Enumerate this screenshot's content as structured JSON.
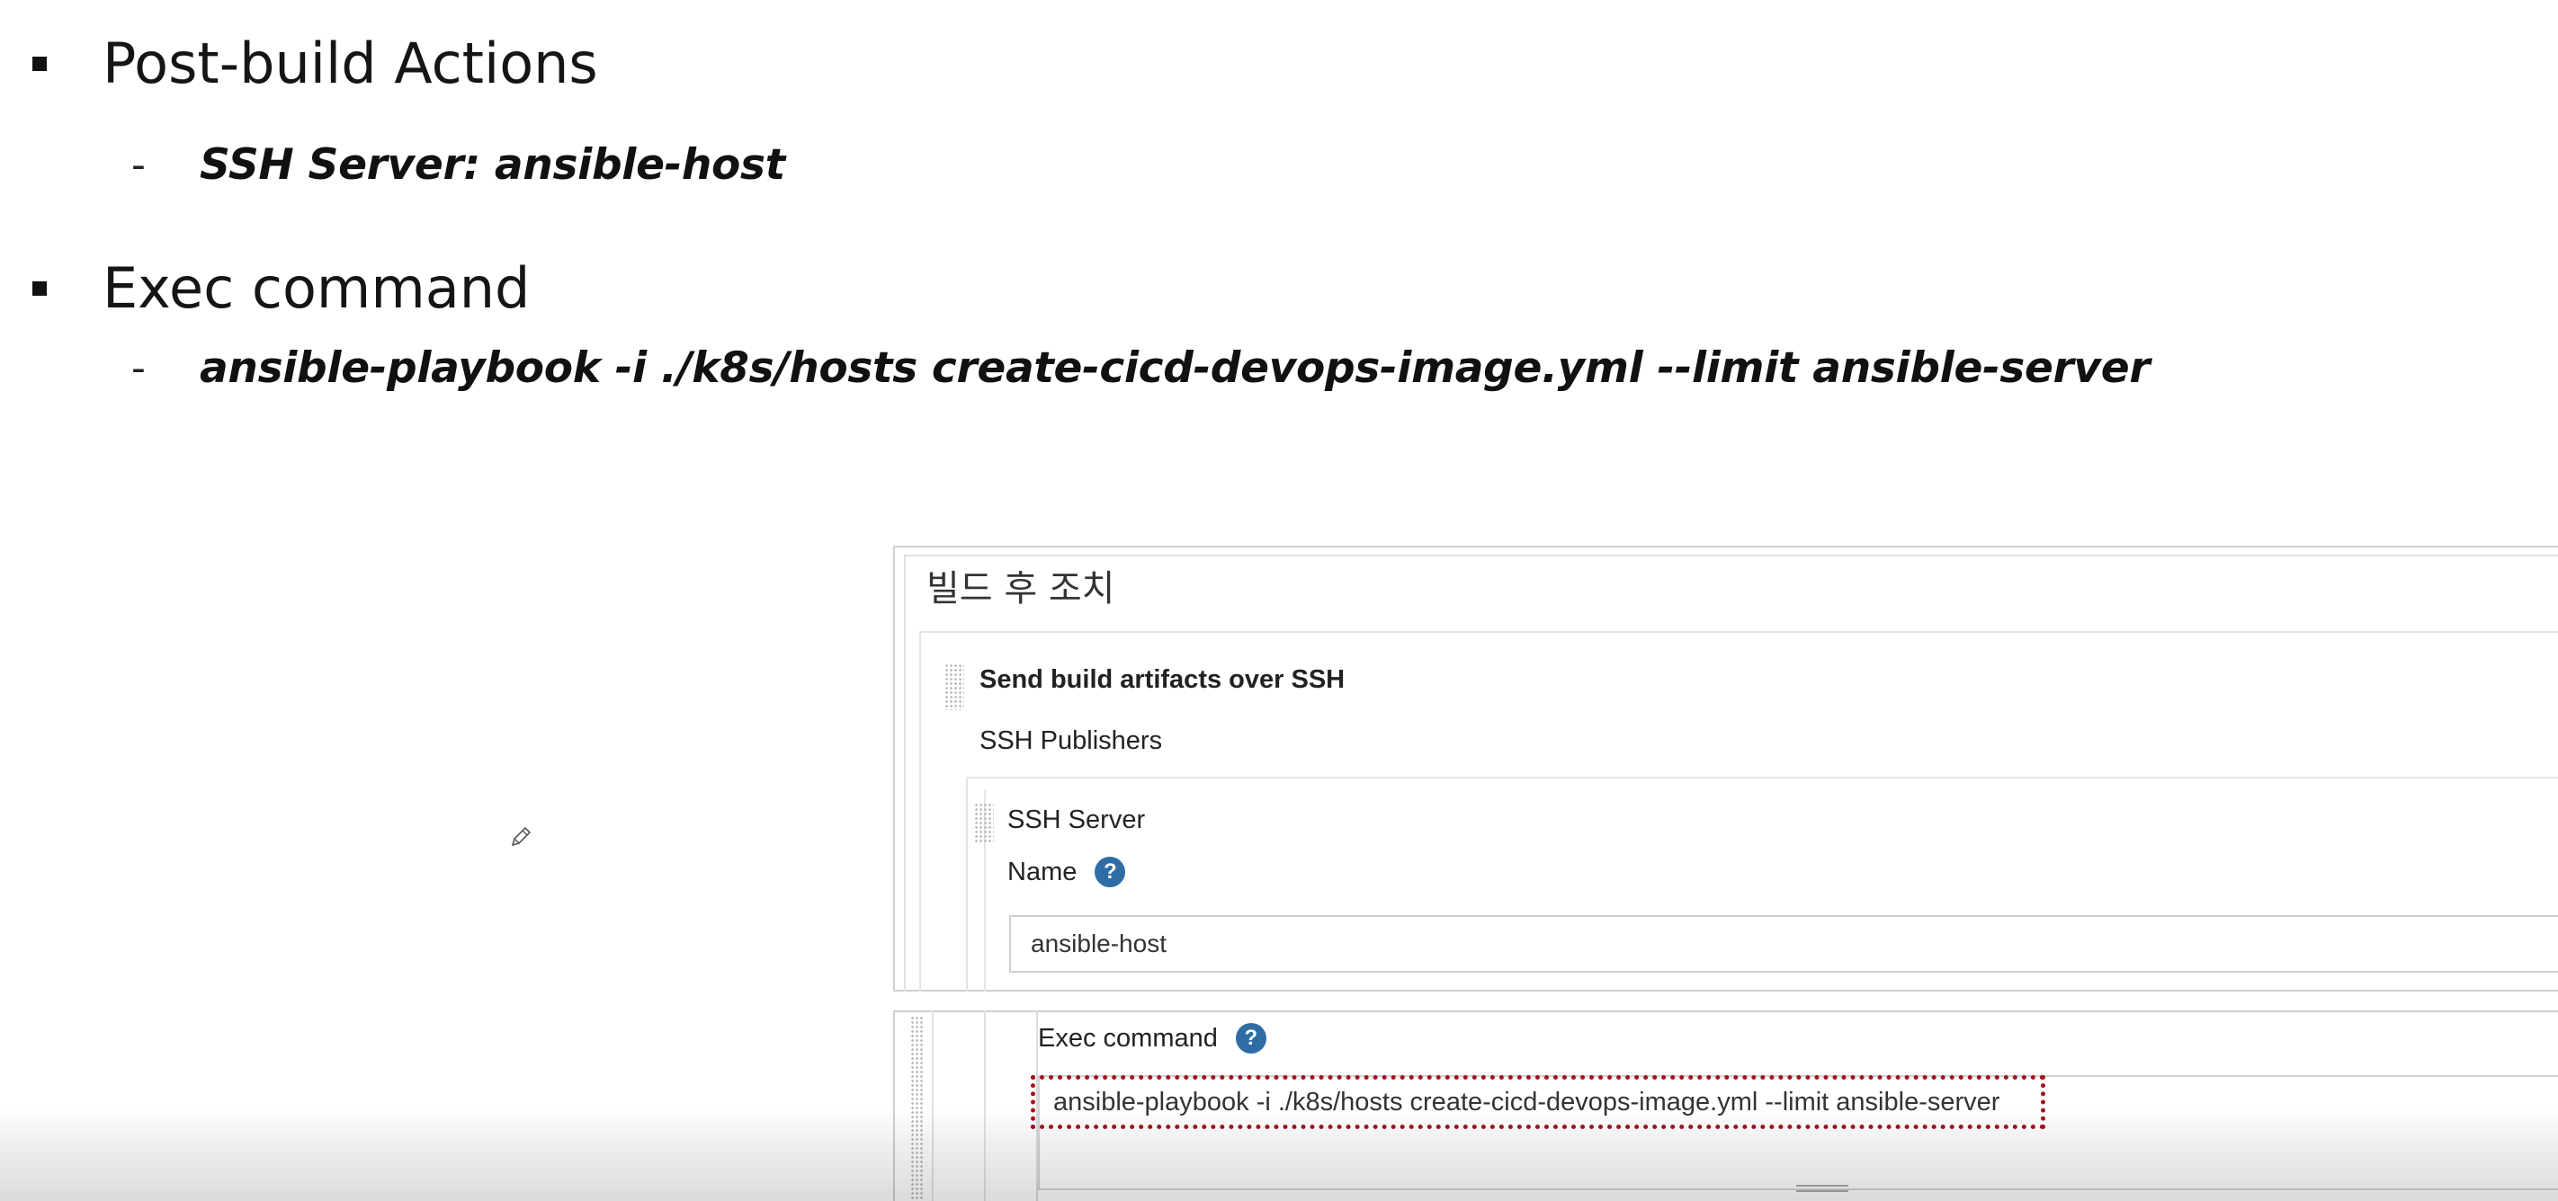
{
  "slide": {
    "bullets": [
      {
        "text": "Post-build Actions",
        "sub": "SSH Server: ansible-host"
      },
      {
        "text": "Exec command",
        "sub": "ansible-playbook -i ./k8s/hosts create-cicd-devops-image.yml --limit ansible-server"
      }
    ],
    "dash": "-"
  },
  "jenkins": {
    "section_title": "빌드 후 조치",
    "step_title": "Send build artifacts over SSH",
    "publishers_label": "SSH Publishers",
    "server_label": "SSH Server",
    "name_label": "Name",
    "name_value": "ansible-host",
    "exec_label": "Exec command",
    "exec_value": "ansible-playbook -i ./k8s/hosts create-cicd-devops-image.yml --limit ansible-server",
    "help_glyph": "?",
    "help_icon_color": "#2e6ca4",
    "highlight_color": "#a3121c"
  }
}
